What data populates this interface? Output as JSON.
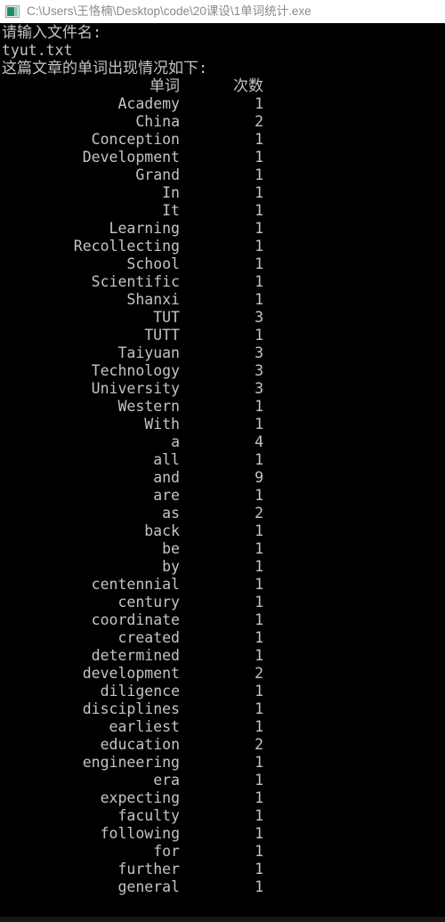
{
  "titlebar": {
    "icon": "console-window-icon",
    "path": "C:\\Users\\王恪楠\\Desktop\\code\\20课设\\1单词统计.exe"
  },
  "console": {
    "background_color": "#000000",
    "text_color": "#c3c3cb",
    "prompt_line": "请输入文件名:",
    "input_value": "tyut.txt",
    "result_heading": "这篇文章的单词出现情况如下:",
    "table": {
      "header": {
        "word": "单词",
        "count": "次数"
      },
      "rows": [
        {
          "word": "Academy",
          "count": "1"
        },
        {
          "word": "China",
          "count": "2"
        },
        {
          "word": "Conception",
          "count": "1"
        },
        {
          "word": "Development",
          "count": "1"
        },
        {
          "word": "Grand",
          "count": "1"
        },
        {
          "word": "In",
          "count": "1"
        },
        {
          "word": "It",
          "count": "1"
        },
        {
          "word": "Learning",
          "count": "1"
        },
        {
          "word": "Recollecting",
          "count": "1"
        },
        {
          "word": "School",
          "count": "1"
        },
        {
          "word": "Scientific",
          "count": "1"
        },
        {
          "word": "Shanxi",
          "count": "1"
        },
        {
          "word": "TUT",
          "count": "3"
        },
        {
          "word": "TUTT",
          "count": "1"
        },
        {
          "word": "Taiyuan",
          "count": "3"
        },
        {
          "word": "Technology",
          "count": "3"
        },
        {
          "word": "University",
          "count": "3"
        },
        {
          "word": "Western",
          "count": "1"
        },
        {
          "word": "With",
          "count": "1"
        },
        {
          "word": "a",
          "count": "4"
        },
        {
          "word": "all",
          "count": "1"
        },
        {
          "word": "and",
          "count": "9"
        },
        {
          "word": "are",
          "count": "1"
        },
        {
          "word": "as",
          "count": "2"
        },
        {
          "word": "back",
          "count": "1"
        },
        {
          "word": "be",
          "count": "1"
        },
        {
          "word": "by",
          "count": "1"
        },
        {
          "word": "centennial",
          "count": "1"
        },
        {
          "word": "century",
          "count": "1"
        },
        {
          "word": "coordinate",
          "count": "1"
        },
        {
          "word": "created",
          "count": "1"
        },
        {
          "word": "determined",
          "count": "1"
        },
        {
          "word": "development",
          "count": "2"
        },
        {
          "word": "diligence",
          "count": "1"
        },
        {
          "word": "disciplines",
          "count": "1"
        },
        {
          "word": "earliest",
          "count": "1"
        },
        {
          "word": "education",
          "count": "2"
        },
        {
          "word": "engineering",
          "count": "1"
        },
        {
          "word": "era",
          "count": "1"
        },
        {
          "word": "expecting",
          "count": "1"
        },
        {
          "word": "faculty",
          "count": "1"
        },
        {
          "word": "following",
          "count": "1"
        },
        {
          "word": "for",
          "count": "1"
        },
        {
          "word": "further",
          "count": "1"
        },
        {
          "word": "general",
          "count": "1"
        }
      ]
    }
  }
}
